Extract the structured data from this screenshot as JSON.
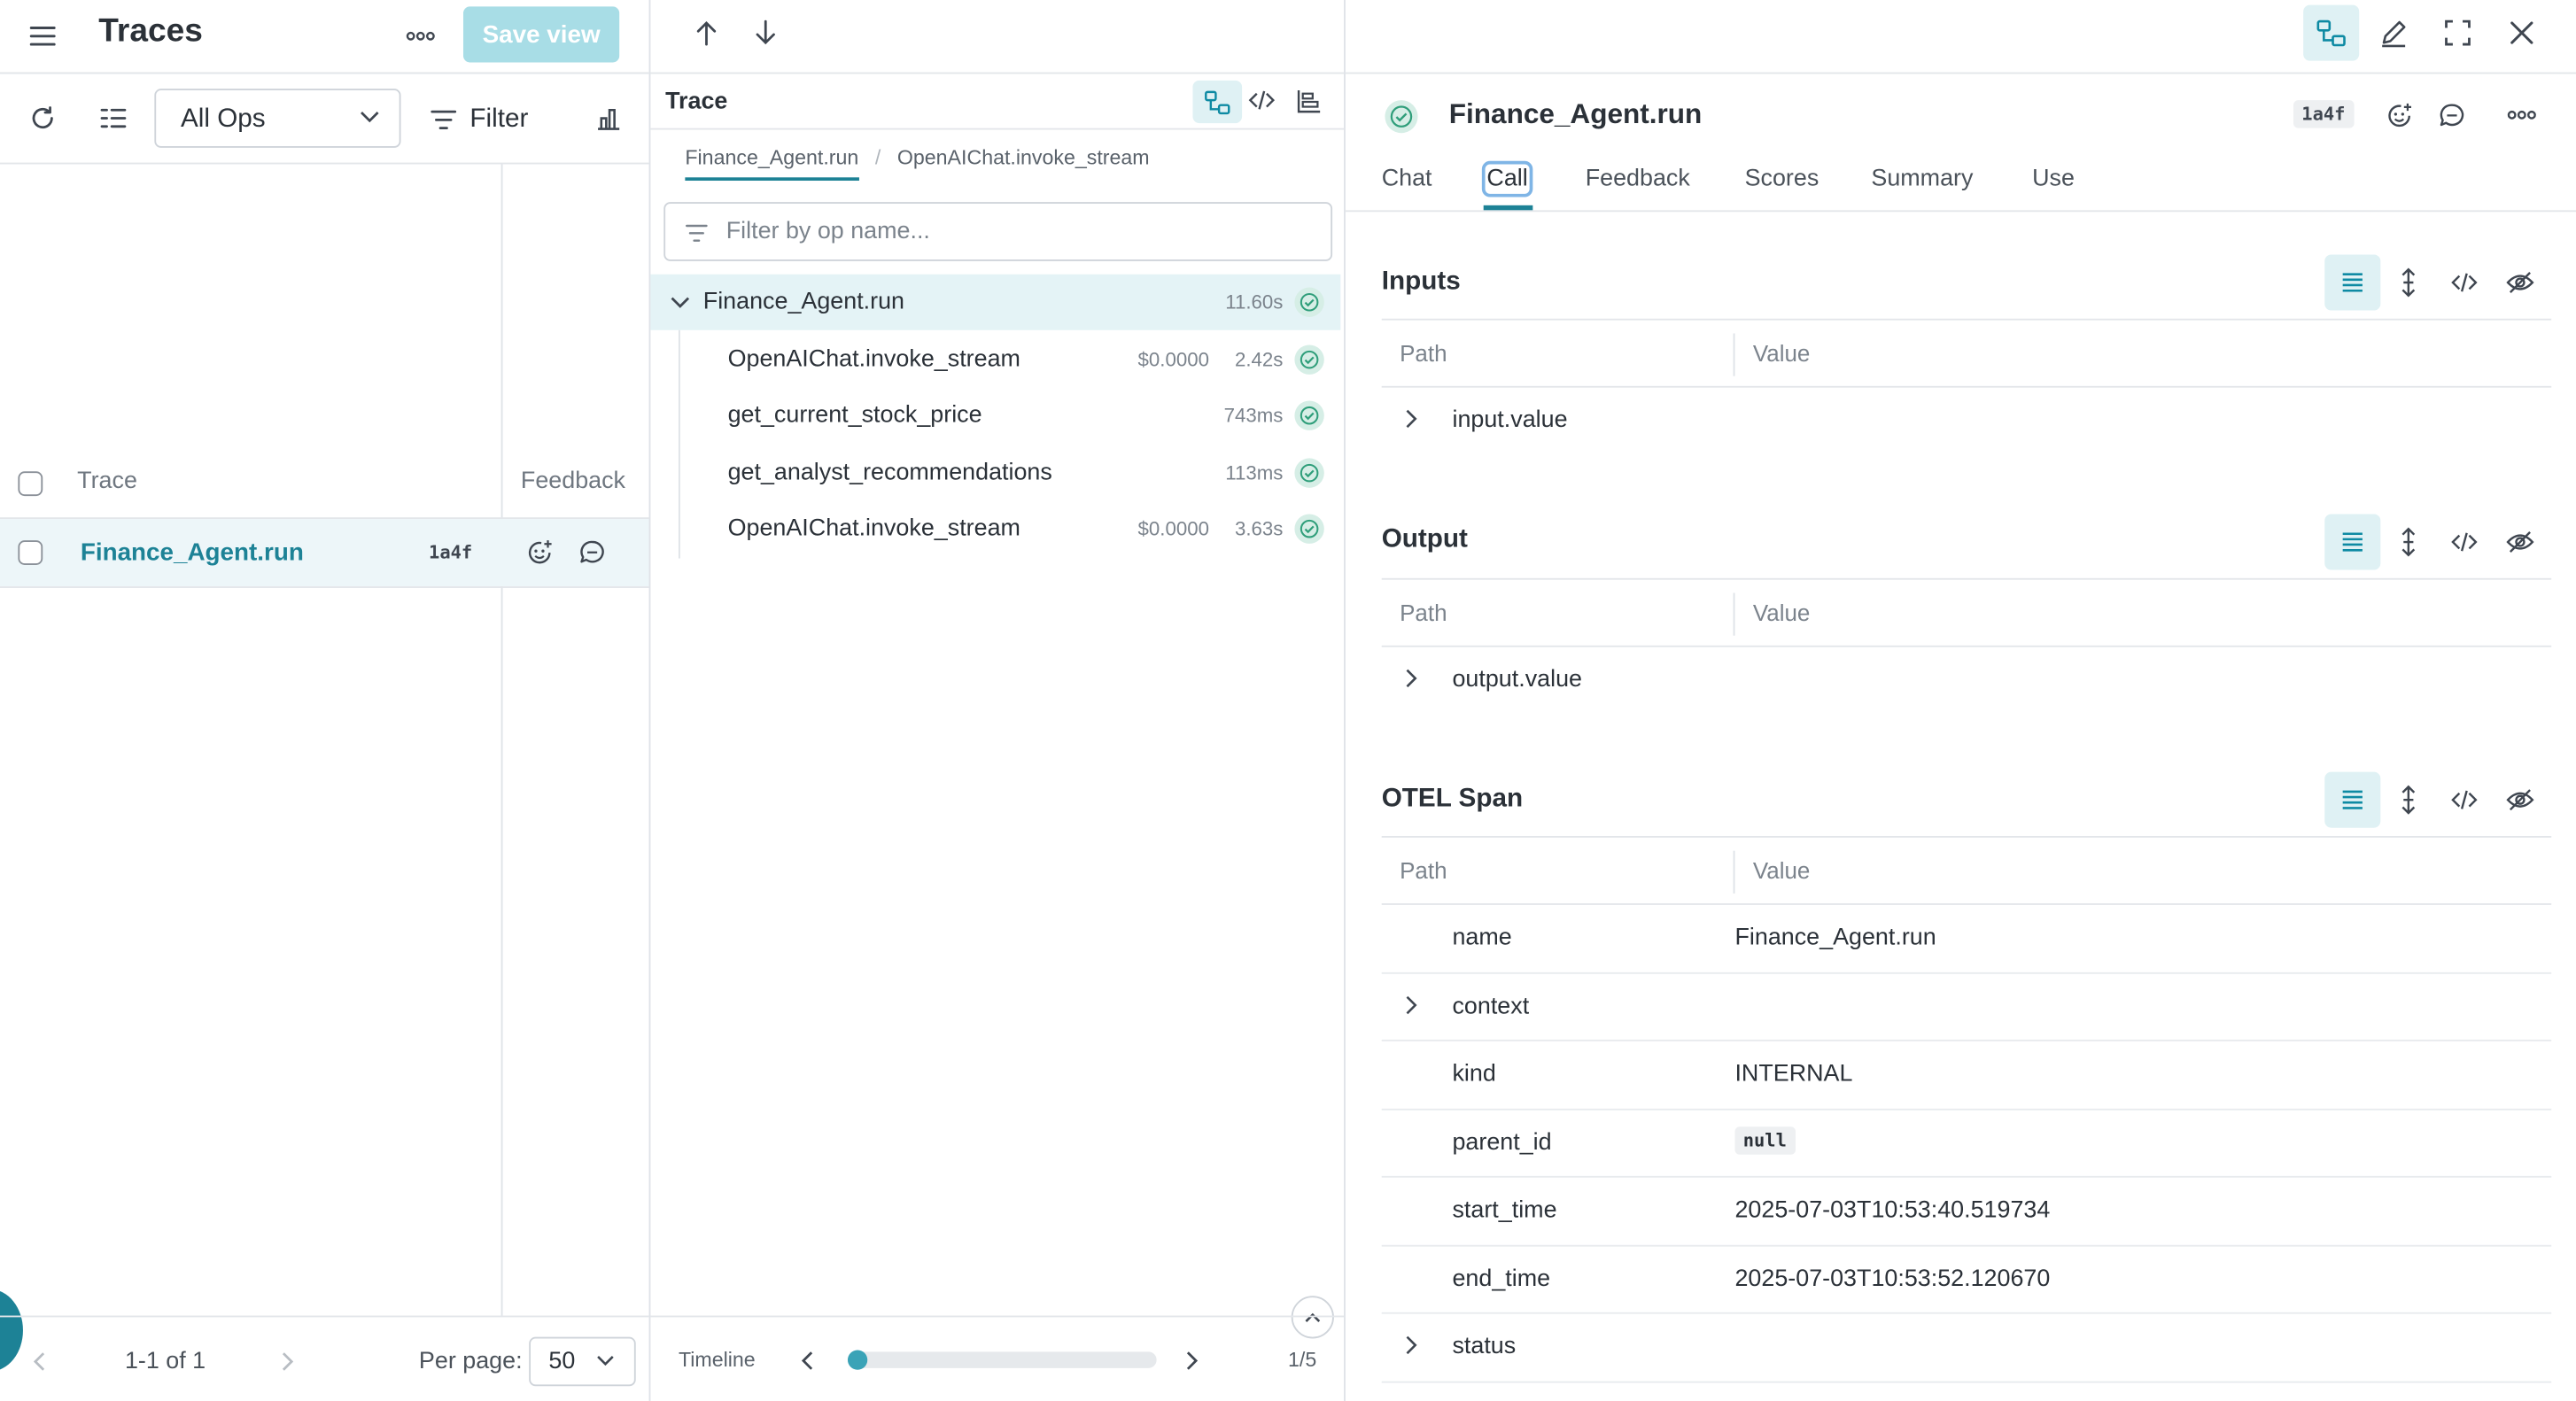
{
  "left": {
    "title": "Traces",
    "save_view": "Save view",
    "ops_select": "All Ops",
    "filter_label": "Filter",
    "col_trace": "Trace",
    "col_feedback": "Feedback",
    "row": {
      "name": "Finance_Agent.run",
      "id": "1a4f"
    },
    "pagination": {
      "range": "1-1 of 1",
      "per_page_label": "Per page:",
      "per_page_value": "50"
    }
  },
  "middle": {
    "title": "Trace",
    "breadcrumb": [
      "Finance_Agent.run",
      "OpenAIChat.invoke_stream"
    ],
    "breadcrumb_sep": "/",
    "filter_placeholder": "Filter by op name...",
    "tree": [
      {
        "name": "Finance_Agent.run",
        "cost": "",
        "time": "11.60s",
        "level": 0
      },
      {
        "name": "OpenAIChat.invoke_stream",
        "cost": "$0.0000",
        "time": "2.42s",
        "level": 1
      },
      {
        "name": "get_current_stock_price",
        "cost": "",
        "time": "743ms",
        "level": 1
      },
      {
        "name": "get_analyst_recommendations",
        "cost": "",
        "time": "113ms",
        "level": 1
      },
      {
        "name": "OpenAIChat.invoke_stream",
        "cost": "$0.0000",
        "time": "3.63s",
        "level": 1
      }
    ],
    "timeline_label": "Timeline",
    "timeline_pos": "1/5",
    "timeline_progress": 0.0
  },
  "right": {
    "title": "Finance_Agent.run",
    "id": "1a4f",
    "tabs": [
      "Chat",
      "Call",
      "Feedback",
      "Scores",
      "Summary",
      "Use"
    ],
    "active_tab": "Call",
    "inputs": {
      "title": "Inputs",
      "path_col": "Path",
      "value_col": "Value",
      "rows": [
        {
          "key": "input.value",
          "value": "",
          "expandable": true
        }
      ]
    },
    "output": {
      "title": "Output",
      "path_col": "Path",
      "value_col": "Value",
      "rows": [
        {
          "key": "output.value",
          "value": "",
          "expandable": true
        }
      ]
    },
    "otel": {
      "title": "OTEL Span",
      "path_col": "Path",
      "value_col": "Value",
      "rows": [
        {
          "key": "name",
          "value": "Finance_Agent.run",
          "expandable": false
        },
        {
          "key": "context",
          "value": "",
          "expandable": true
        },
        {
          "key": "kind",
          "value": "INTERNAL",
          "expandable": false
        },
        {
          "key": "parent_id",
          "value": "null",
          "expandable": false
        },
        {
          "key": "start_time",
          "value": "2025-07-03T10:53:40.519734",
          "expandable": false
        },
        {
          "key": "end_time",
          "value": "2025-07-03T10:53:52.120670",
          "expandable": false
        },
        {
          "key": "status",
          "value": "",
          "expandable": true
        }
      ]
    }
  },
  "colors": {
    "accent": "#1d8296",
    "accent_bg": "#dff1f4",
    "save_btn": "#a8dde6",
    "row_selected": "#edf6f9"
  }
}
